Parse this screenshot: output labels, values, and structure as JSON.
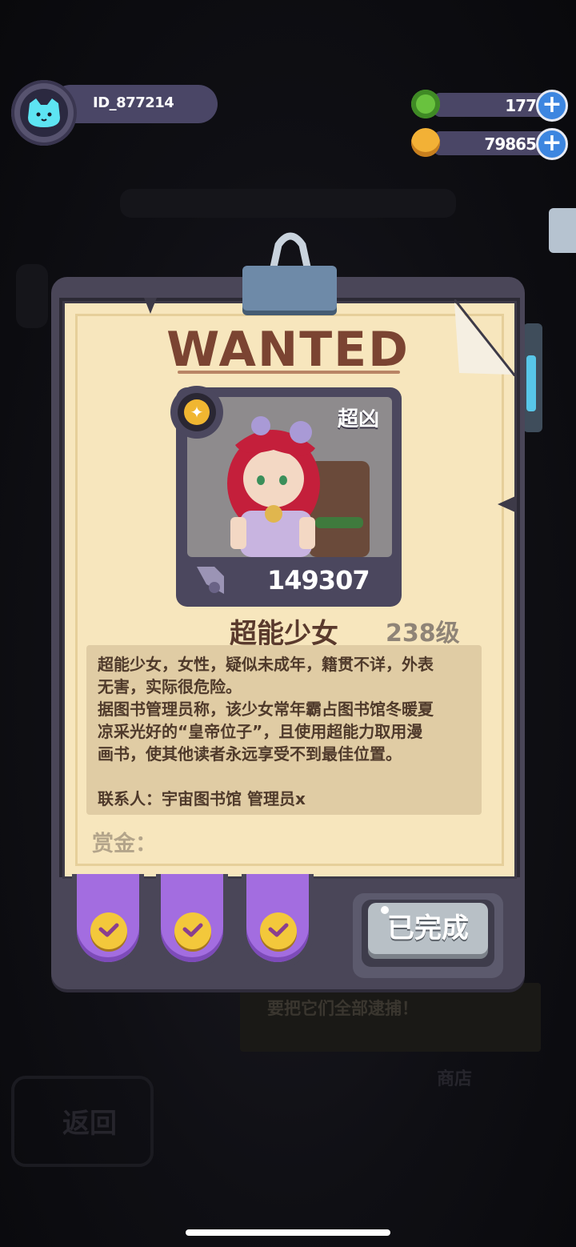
{
  "hud": {
    "player_id": "ID_877214",
    "avatar_icon": "cat-face-icon",
    "currency": [
      {
        "icon": "green-gem-icon",
        "value": "177",
        "add_icon": "plus-icon",
        "color": "#69c23e"
      },
      {
        "icon": "gold-planet-coin-icon",
        "value": "79865",
        "add_icon": "plus-icon",
        "color": "#f2b136"
      }
    ]
  },
  "poster": {
    "header": "WANTED",
    "tag": "超凶",
    "bounty_value": "149307",
    "bounty_icon": "sword-icon",
    "rank_icon": "star-badge-icon",
    "portrait_icon": "red-haired-girl-portrait",
    "name": "超能少女",
    "level": "238级",
    "description": [
      "超能少女，女性，疑似未成年，籍贯不详，外表",
      "无害，实际很危险。",
      "据图书管理员称，该少女常年霸占图书馆冬暖夏",
      "凉采光好的“皇帝位子”，且使用超能力取用漫",
      "画书，使其他读者永远享受不到最佳位置。"
    ],
    "contact": "联系人：宇宙图书馆 管理员x",
    "reward_label": "赏金：",
    "tabs": [
      {
        "icon": "check-icon",
        "checked": true
      },
      {
        "icon": "check-icon",
        "checked": true
      },
      {
        "icon": "check-icon",
        "checked": true
      }
    ],
    "done_button": "已完成"
  },
  "background": {
    "hint_text": "要把它们全部逮捕！",
    "back_label": "返回",
    "shop_label": "商店"
  },
  "colors": {
    "paper": "#f7e6bd",
    "frame": "#4a4658",
    "title": "#7b4432",
    "tab_purple": "#a36de0",
    "check_gold": "#f3c83b"
  }
}
